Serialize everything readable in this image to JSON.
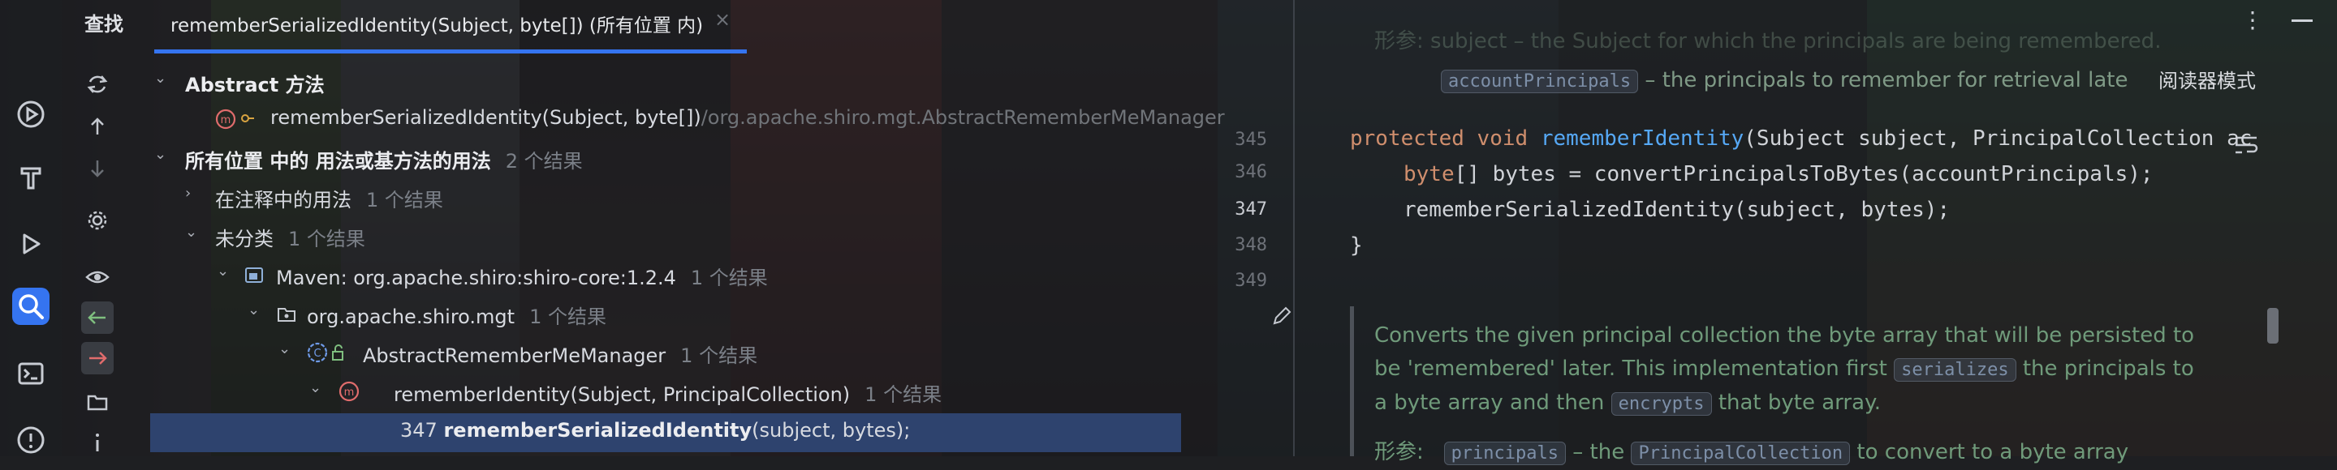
{
  "panel_title": "查找",
  "tab": {
    "label": "rememberSerializedIdentity(Subject, byte[]) (所有位置 内)",
    "close_glyph": "×"
  },
  "icons": {
    "refresh": "refresh-icon",
    "prev": "arrow-up-icon",
    "next": "arrow-down-icon",
    "settings": "gear-icon",
    "preview": "eye-icon",
    "more": "more-vertical-icon",
    "minimize": "minimize-icon"
  },
  "tree": {
    "abstract": "Abstract 方法",
    "method_sig": "rememberSerializedIdentity(Subject, byte[])",
    "method_path": "/org.apache.shiro.mgt.AbstractRememberMeManager",
    "usages_prefix": "所有位置",
    "usages_mid": "中的",
    "usages_rest": "用法或基方法的用法",
    "usages_count": "2 个结果",
    "in_comments": "在注释中的用法",
    "in_comments_count": "1 个结果",
    "uncategorized": "未分类",
    "uncategorized_count": "1 个结果",
    "maven": "Maven: org.apache.shiro:shiro-core:1.2.4",
    "maven_count": "1 个结果",
    "package": "org.apache.shiro.mgt",
    "package_count": "1 个结果",
    "class": "AbstractRememberMeManager",
    "class_count": "1 个结果",
    "method2": "rememberIdentity(Subject, PrincipalCollection)",
    "method2_count": "1 个结果",
    "result_line": "347",
    "result_bold": "rememberSerializedIdentity",
    "result_rest": "(subject, bytes);"
  },
  "editor": {
    "top_doc_text": "形参: subject – the Subject for which the principals are being remembered.",
    "doc_param_code": "accountPrincipals",
    "doc_param_desc": " – the principals to remember for retrieval late",
    "reader_mode": "阅读器模式",
    "lines": [
      "345",
      "346",
      "347",
      "348",
      "349"
    ],
    "code": {
      "l345_kw1": "protected",
      "l345_kw2": "void",
      "l345_fn": "rememberIdentity",
      "l345_rest": "(Subject subject, PrincipalCollection ac",
      "l346_kw": "byte",
      "l346_rest": "[] bytes = convertPrincipalsToBytes(accountPrincipals);",
      "l347": "rememberSerializedIdentity(subject, bytes);",
      "l348": "}"
    },
    "doc": {
      "p1": "Converts the given principal collection the byte array that will be persisted to be 'remembered' later. This implementation first",
      "serializes": "serializes",
      "p2": "the principals to a byte array and then",
      "encrypts": "encrypts",
      "p3": "that byte array.",
      "bottom_label": "形参:",
      "bottom_code1": "principals",
      "bottom_mid": " – the ",
      "bottom_code2": "PrincipalCollection",
      "bottom_rest": " to convert to a byte array"
    }
  },
  "colors": {
    "accent": "#3574f0",
    "selection": "#2e436e",
    "keyword": "#cf8e6d",
    "function": "#56a8f5",
    "doc_text": "#6f9a7a"
  }
}
